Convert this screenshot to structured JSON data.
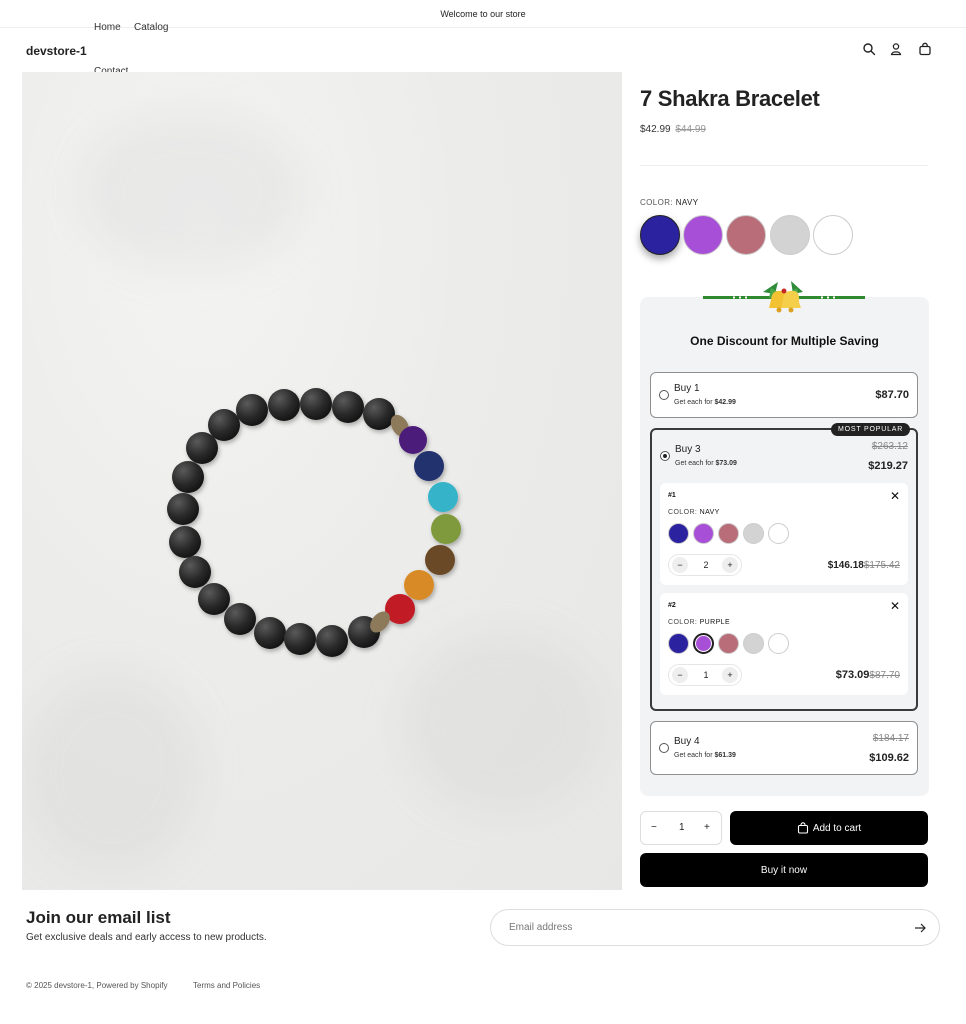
{
  "announcement": "Welcome to our store",
  "brand": "devstore-1",
  "nav": {
    "home": "Home",
    "catalog": "Catalog",
    "contact": "Contact"
  },
  "icons": {
    "search": "search-icon",
    "account": "account-icon",
    "cart": "cart-icon"
  },
  "product": {
    "title": "7 Shakra Bracelet",
    "price": "$42.99",
    "compare_price": "$44.99",
    "color_label": "COLOR:",
    "color_value": "NAVY",
    "swatches": [
      {
        "name": "Navy",
        "hex": "#2b22a0"
      },
      {
        "name": "Purple",
        "hex": "#a74fd6"
      },
      {
        "name": "Rose",
        "hex": "#b96d78"
      },
      {
        "name": "Light Gray",
        "hex": "#d3d3d3"
      },
      {
        "name": "White",
        "hex": "#ffffff"
      }
    ]
  },
  "bundle": {
    "heading": "One Discount for Multiple Saving",
    "badge": "MOST POPULAR",
    "tiers": [
      {
        "name": "Buy 1",
        "sub_prefix": "Get each for",
        "sub_value": "$42.99",
        "price": "$87.70",
        "compare": ""
      },
      {
        "name": "Buy 3",
        "sub_prefix": "Get each for",
        "sub_value": "$73.09",
        "price": "$219.27",
        "compare": "$263.12"
      },
      {
        "name": "Buy 4",
        "sub_prefix": "Get each for",
        "sub_value": "$61.39",
        "price": "$109.62",
        "compare": "$184.17"
      }
    ],
    "items": [
      {
        "num": "#1",
        "color_label": "COLOR:",
        "color_value": "NAVY",
        "qty": "2",
        "price": "$146.18",
        "compare": "$175.42"
      },
      {
        "num": "#2",
        "color_label": "COLOR:",
        "color_value": "PURPLE",
        "qty": "1",
        "price": "$73.09",
        "compare": "$87.70"
      }
    ],
    "minus": "−",
    "plus": "+",
    "close": "✕"
  },
  "purchase": {
    "qty_minus": "−",
    "qty_value": "1",
    "qty_plus": "+",
    "add_to_cart": "Add to cart",
    "buy_now": "Buy it now"
  },
  "newsletter": {
    "title": "Join our email list",
    "subtitle": "Get exclusive deals and early access to new products.",
    "placeholder": "Email address"
  },
  "footer": {
    "copyright": "© 2025 devstore-1, Powered by Shopify",
    "terms": "Terms and Policies"
  },
  "colors": {
    "accent": "#000000",
    "panel": "#f2f3f5"
  }
}
